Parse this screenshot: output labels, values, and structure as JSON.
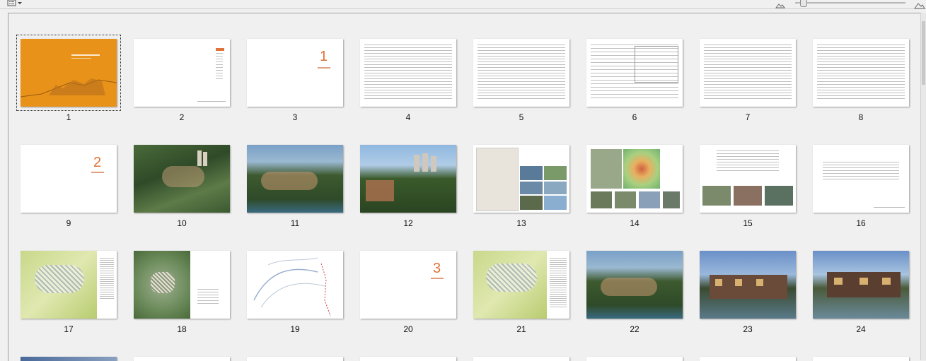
{
  "toolbar": {
    "view_icon": "thumbnail-view-icon",
    "zoom_out_icon": "mountain-small-icon",
    "zoom_in_icon": "mountain-large-icon"
  },
  "pages": [
    "1",
    "2",
    "3",
    "4",
    "5",
    "6",
    "7",
    "8",
    "9",
    "10",
    "11",
    "12",
    "13",
    "14",
    "15",
    "16",
    "17",
    "18",
    "19",
    "20",
    "21",
    "22",
    "23",
    "24"
  ],
  "section_numbers": {
    "p3": "1",
    "p9": "2",
    "p20": "3"
  },
  "colors": {
    "cover_orange": "#e8921a",
    "section_red": "#e0733a"
  }
}
